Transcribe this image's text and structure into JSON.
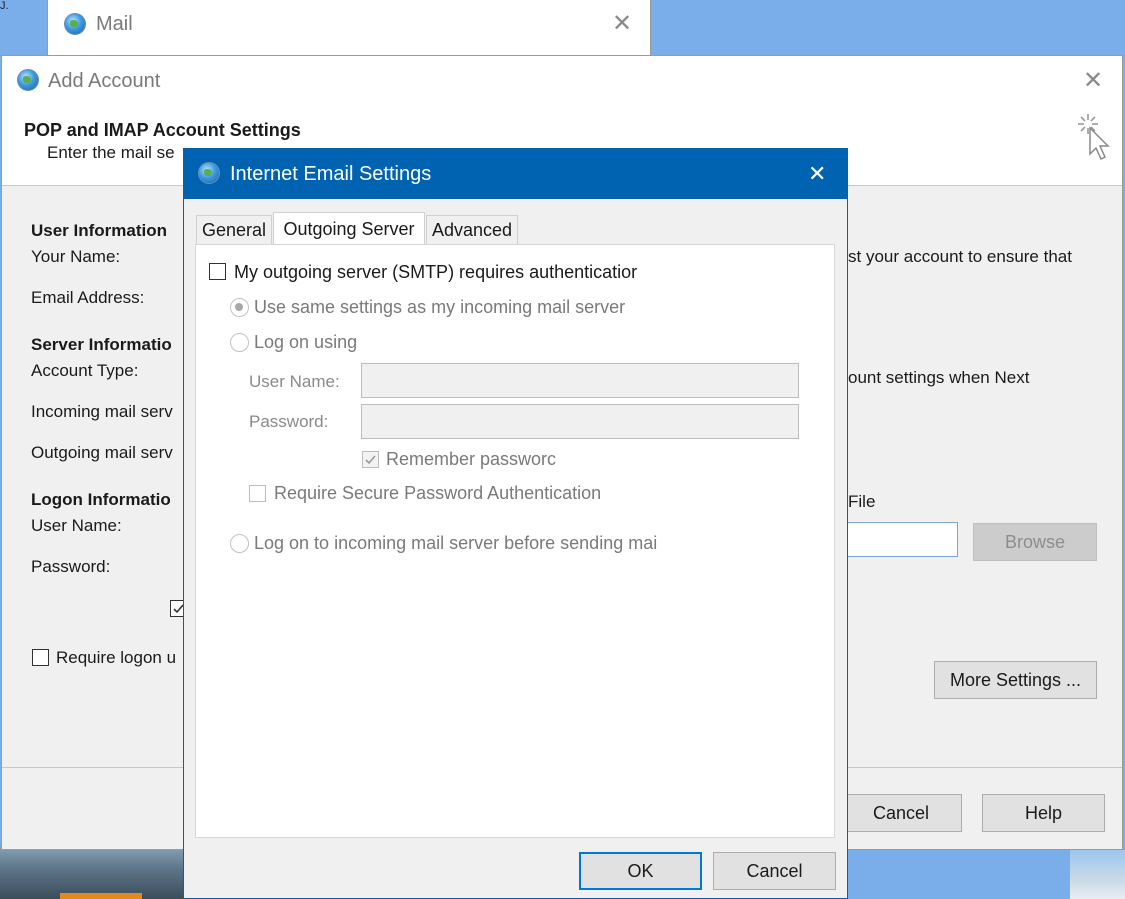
{
  "desktop": {
    "corner_glyph": "J."
  },
  "mail_window": {
    "title": "Mail",
    "icon": "mail-globe-icon"
  },
  "add_account": {
    "title": "Add Account",
    "heading": "POP and IMAP Account Settings",
    "subheading": "Enter the mail se",
    "user_info_header": "User Information",
    "your_name_label": "Your Name:",
    "email_label": "Email Address:",
    "server_info_header": "Server Informatio",
    "account_type_label": "Account Type:",
    "incoming_label": "Incoming mail serv",
    "outgoing_label": "Outgoing mail serv",
    "logon_info_header": "Logon Informatio",
    "user_name_label": "User Name:",
    "password_label": "Password:",
    "require_logon_label": "Require logon u",
    "right_text_1": "st your account to ensure that",
    "right_text_2": "ount settings when Next",
    "right_text_3": "File",
    "browse_label": "Browse",
    "more_settings_label": "More Settings ...",
    "cancel_label": "Cancel",
    "help_label": "Help"
  },
  "email_settings": {
    "title": "Internet Email Settings",
    "tabs": [
      {
        "label": "General",
        "active": false
      },
      {
        "label": "Outgoing Server",
        "active": true
      },
      {
        "label": "Advanced",
        "active": false
      }
    ],
    "smtp_auth_label": "My outgoing server (SMTP) requires authenticatior",
    "smtp_auth_checked": false,
    "same_settings_label": "Use same settings as my incoming mail server",
    "log_on_using_label": "Log on using",
    "user_name_label": "User Name:",
    "user_name_value": "",
    "password_label": "Password:",
    "password_value": "",
    "remember_password_label": "Remember passworc",
    "remember_password_checked": true,
    "spa_label": "Require Secure Password Authentication",
    "spa_checked": false,
    "log_on_incoming_label": "Log on to incoming mail server before sending mai",
    "ok_label": "OK",
    "cancel_label": "Cancel"
  },
  "colors": {
    "desktop": "#79aeea",
    "dialog_titlebar": "#0063b1",
    "default_button_border": "#0078d7"
  }
}
